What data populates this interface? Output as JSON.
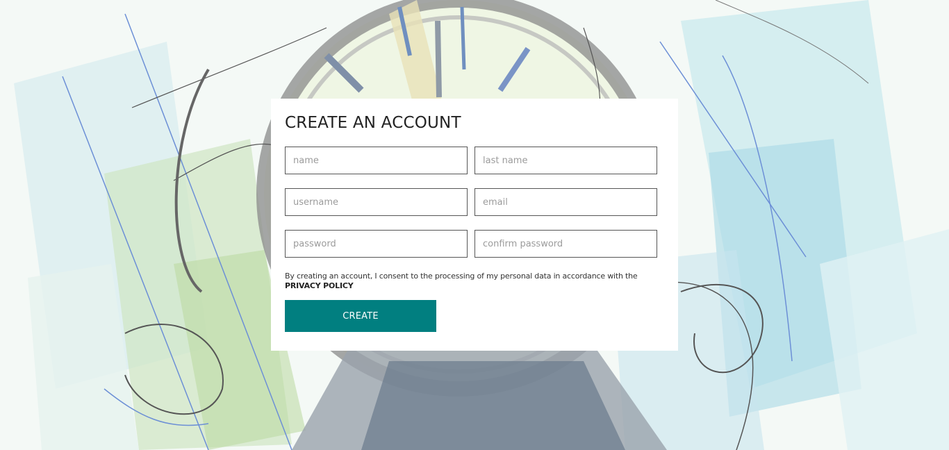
{
  "form": {
    "title": "CREATE AN ACCOUNT",
    "fields": {
      "name": {
        "placeholder": "name",
        "value": ""
      },
      "last_name": {
        "placeholder": "last name",
        "value": ""
      },
      "username": {
        "placeholder": "username",
        "value": ""
      },
      "email": {
        "placeholder": "email",
        "value": ""
      },
      "password": {
        "placeholder": "password",
        "value": ""
      },
      "confirm_password": {
        "placeholder": "confirm password",
        "value": ""
      }
    },
    "consent_text": "By creating an account, I consent to the processing of my personal data in accordance with the ",
    "privacy_link": "PRIVACY POLICY",
    "submit_label": "CREATE"
  },
  "colors": {
    "accent": "#017f80",
    "card_background": "#ffffff",
    "field_border": "#555555",
    "placeholder": "#9b9b9b"
  },
  "background": {
    "icon": "watch-sketch-illustration"
  }
}
